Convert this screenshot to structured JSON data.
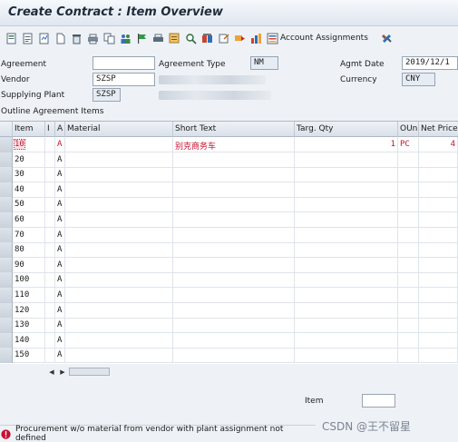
{
  "title": "Create Contract : Item Overview",
  "toolbar": {
    "icons": [
      "header-details-icon",
      "item-details-icon",
      "conditions-icon",
      "new-document-icon",
      "delete-icon",
      "print-icon",
      "copy-icon",
      "partners-icon",
      "flag-icon",
      "print-preview-icon",
      "search-icon",
      "calendar-icon",
      "edit-icon",
      "transfer-icon",
      "users-icon",
      "chart-icon"
    ],
    "account_assignments_label": "Account Assignments"
  },
  "header": {
    "agreement_label": "Agreement",
    "agreement_value": "",
    "agreement_type_label": "Agreement Type",
    "agreement_type_value": "NM",
    "agmt_date_label": "Agmt Date",
    "agmt_date_value": "2019/12/1",
    "vendor_label": "Vendor",
    "vendor_value": "SZSP",
    "currency_label": "Currency",
    "currency_value": "CNY",
    "supplying_plant_label": "Supplying Plant",
    "supplying_plant_value": "SZSP"
  },
  "items_section_title": "Outline Agreement Items",
  "table": {
    "columns": [
      "Item",
      "I",
      "A",
      "Material",
      "Short Text",
      "Targ. Qty",
      "OUn",
      "Net Price"
    ],
    "rows": [
      {
        "item": "10",
        "a": "A",
        "short_text": "别克商务车",
        "qty": "1",
        "oun": "PC",
        "price": "4"
      },
      {
        "item": "20",
        "a": "A"
      },
      {
        "item": "30",
        "a": "A"
      },
      {
        "item": "40",
        "a": "A"
      },
      {
        "item": "50",
        "a": "A"
      },
      {
        "item": "60",
        "a": "A"
      },
      {
        "item": "70",
        "a": "A"
      },
      {
        "item": "80",
        "a": "A"
      },
      {
        "item": "90",
        "a": "A"
      },
      {
        "item": "100",
        "a": "A"
      },
      {
        "item": "110",
        "a": "A"
      },
      {
        "item": "120",
        "a": "A"
      },
      {
        "item": "130",
        "a": "A"
      },
      {
        "item": "140",
        "a": "A"
      },
      {
        "item": "150",
        "a": "A"
      }
    ]
  },
  "footer": {
    "item_label": "Item",
    "item_value": ""
  },
  "status_message": "Procurement w/o material from vendor with plant assignment not defined",
  "watermark": "CSDN @王不留星",
  "colors": {
    "accent": "#c8102e",
    "header_bg": "#d9e0e9",
    "page_bg": "#eef2f7"
  }
}
